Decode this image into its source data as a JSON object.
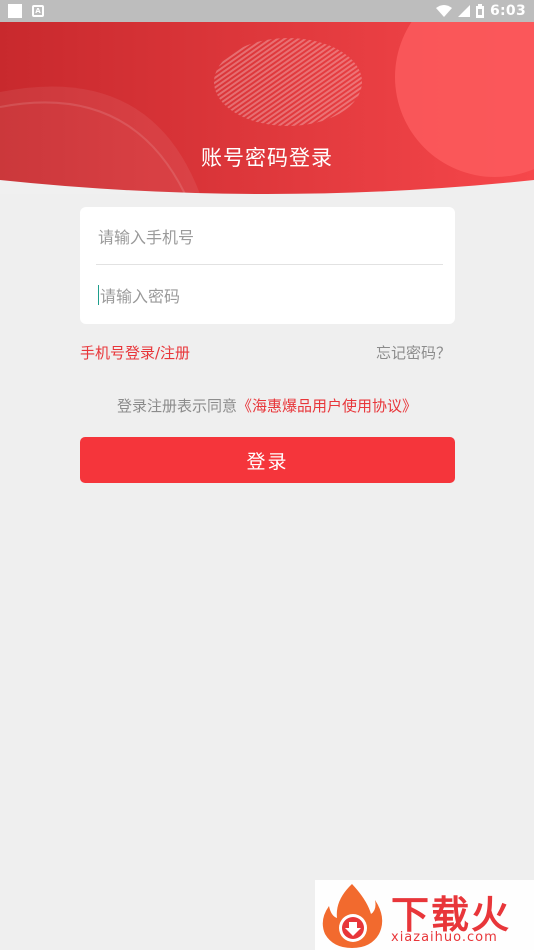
{
  "status_bar": {
    "time": "6:03",
    "icons": [
      "notification-square-icon",
      "a-icon",
      "wifi-icon",
      "cell-signal-icon",
      "battery-icon"
    ]
  },
  "header": {
    "title": "账号密码登录",
    "gradient_start": "#c8292d",
    "gradient_end": "#f6474b"
  },
  "form": {
    "phone_placeholder": "请输入手机号",
    "password_placeholder": "请输入密码"
  },
  "links": {
    "phone_login": "手机号登录/注册",
    "forgot_password": "忘记密码？"
  },
  "agreement": {
    "prefix": "登录注册表示同意",
    "link": "《海惠爆品用户使用协议》"
  },
  "login_button": {
    "label": "登录",
    "color": "#f5353b"
  },
  "watermark": {
    "brand_cn": "下载火",
    "brand_en": "xiazaihuo.com",
    "color": "#e8363a"
  }
}
